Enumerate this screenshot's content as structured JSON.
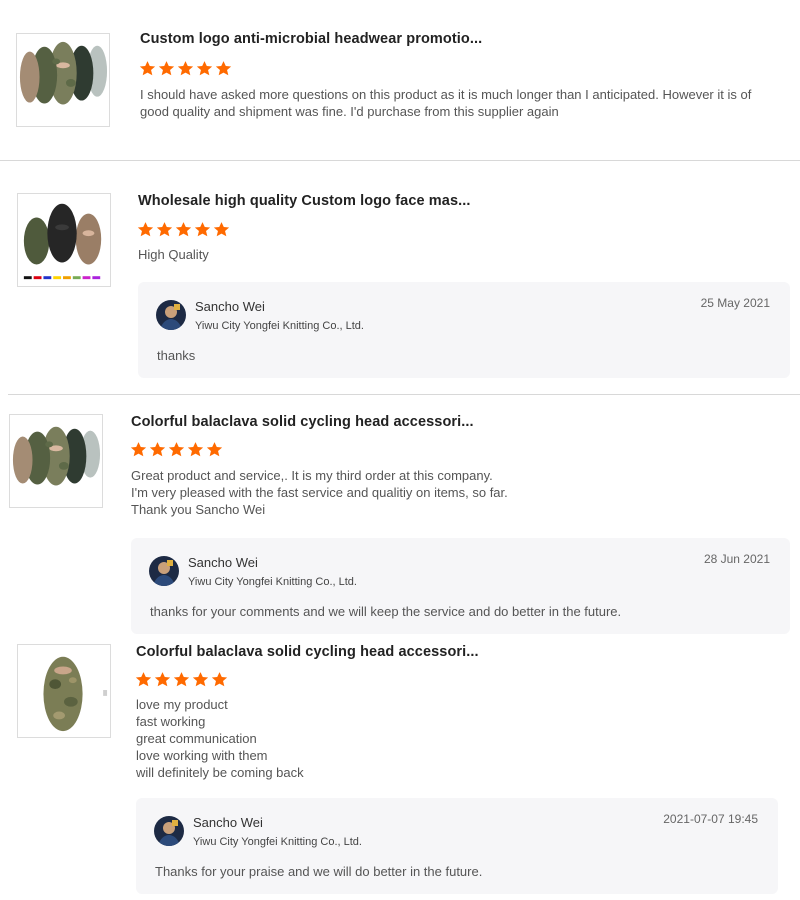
{
  "colors": {
    "star": "#ff6a00",
    "reply_bg": "#f6f6f8",
    "divider": "#d8d8d8"
  },
  "reviews": [
    {
      "title": "Custom logo anti-microbial headwear promotio...",
      "rating": 5,
      "thumbnail_icon": "balaclava-group-product-image",
      "text": "I should have asked more questions on this product as it is much longer than I anticipated.  However it is of good quality and shipment was fine. I'd purchase from this supplier again"
    },
    {
      "title": "Wholesale high quality Custom logo face mas...",
      "rating": 5,
      "thumbnail_icon": "balaclava-trio-product-image",
      "text": "High Quality",
      "reply": {
        "name": "Sancho Wei",
        "company": "Yiwu City Yongfei Knitting Co., Ltd.",
        "date": "25 May 2021",
        "text": "thanks"
      }
    },
    {
      "title": "Colorful balaclava solid cycling head accessori...",
      "rating": 5,
      "thumbnail_icon": "balaclava-group-product-image",
      "text": "Great product and service,.  It is my third order at this company.\nI'm very pleased with the fast service and qualitiy on items, so far.\nThank you Sancho Wei",
      "reply": {
        "name": "Sancho Wei",
        "company": "Yiwu City Yongfei Knitting Co., Ltd.",
        "date": "28 Jun 2021",
        "text": "thanks for your comments and we will keep the service and do better in the future."
      }
    },
    {
      "title": "Colorful balaclava solid cycling head accessori...",
      "rating": 5,
      "thumbnail_icon": "camo-balaclava-product-image",
      "text": "love my product\nfast working\ngreat communication\nlove working with them\nwill definitely be coming back",
      "reply": {
        "name": "Sancho Wei",
        "company": "Yiwu City Yongfei Knitting Co., Ltd.",
        "date": "2021-07-07 19:45",
        "text": "Thanks for your praise and we will do better in the future."
      }
    }
  ]
}
